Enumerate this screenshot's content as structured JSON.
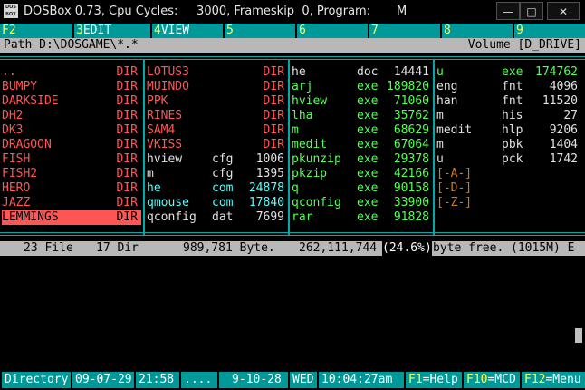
{
  "titlebar": {
    "icon_text": "DOS\nBOX",
    "title": "DOSBox 0.73, Cpu Cycles:     3000, Frameskip  0, Program:       M",
    "minimize_icon": "minimize-icon",
    "maximize_icon": "maximize-icon",
    "close_icon": "close-icon"
  },
  "fkeys": [
    {
      "key": "F2",
      "label": ""
    },
    {
      "key": "3",
      "label": "EDIT"
    },
    {
      "key": "4",
      "label": "VIEW"
    },
    {
      "key": "5",
      "label": ""
    },
    {
      "key": "6",
      "label": ""
    },
    {
      "key": "7",
      "label": ""
    },
    {
      "key": "8",
      "label": ""
    },
    {
      "key": "9",
      "label": ""
    }
  ],
  "pathbar": {
    "path": "Path D:\\DOSGAME\\*.*",
    "volume": "Volume [D_DRIVE]"
  },
  "panel": {
    "col1": [
      {
        "name": "..",
        "type": "DIR",
        "selected": false
      },
      {
        "name": "BUMPY",
        "type": "DIR",
        "selected": false
      },
      {
        "name": "DARKSIDE",
        "type": "DIR",
        "selected": false
      },
      {
        "name": "DH2",
        "type": "DIR",
        "selected": false
      },
      {
        "name": "DK3",
        "type": "DIR",
        "selected": false
      },
      {
        "name": "DRAGOON",
        "type": "DIR",
        "selected": false
      },
      {
        "name": "FISH",
        "type": "DIR",
        "selected": false
      },
      {
        "name": "FISH2",
        "type": "DIR",
        "selected": false
      },
      {
        "name": "HERO",
        "type": "DIR",
        "selected": false
      },
      {
        "name": "JAZZ",
        "type": "DIR",
        "selected": false
      },
      {
        "name": "LEMMINGS",
        "type": "DIR",
        "selected": true
      }
    ],
    "col2": [
      {
        "name": "LOTUS3",
        "ext": "",
        "size": "DIR",
        "color": "red"
      },
      {
        "name": "MUINDO",
        "ext": "",
        "size": "DIR",
        "color": "red"
      },
      {
        "name": "PPK",
        "ext": "",
        "size": "DIR",
        "color": "red"
      },
      {
        "name": "RINES",
        "ext": "",
        "size": "DIR",
        "color": "red"
      },
      {
        "name": "SAM4",
        "ext": "",
        "size": "DIR",
        "color": "red"
      },
      {
        "name": "VKISS",
        "ext": "",
        "size": "DIR",
        "color": "red"
      },
      {
        "name": "hview",
        "ext": "cfg",
        "size": "1006",
        "color": "white"
      },
      {
        "name": "m",
        "ext": "cfg",
        "size": "1395",
        "color": "white"
      },
      {
        "name": "he",
        "ext": "com",
        "size": "24878",
        "color": "cyan"
      },
      {
        "name": "qmouse",
        "ext": "com",
        "size": "17840",
        "color": "cyan"
      },
      {
        "name": "qconfig",
        "ext": "dat",
        "size": "7699",
        "color": "white"
      }
    ],
    "col3": [
      {
        "name": "he",
        "ext": "doc",
        "size": "14441",
        "color": "white"
      },
      {
        "name": "arj",
        "ext": "exe",
        "size": "189820",
        "color": "green"
      },
      {
        "name": "hview",
        "ext": "exe",
        "size": "71060",
        "color": "green"
      },
      {
        "name": "lha",
        "ext": "exe",
        "size": "35762",
        "color": "green"
      },
      {
        "name": "m",
        "ext": "exe",
        "size": "68629",
        "color": "green"
      },
      {
        "name": "medit",
        "ext": "exe",
        "size": "67064",
        "color": "green"
      },
      {
        "name": "pkunzip",
        "ext": "exe",
        "size": "29378",
        "color": "green"
      },
      {
        "name": "pkzip",
        "ext": "exe",
        "size": "42166",
        "color": "green"
      },
      {
        "name": "q",
        "ext": "exe",
        "size": "90158",
        "color": "green"
      },
      {
        "name": "qconfig",
        "ext": "exe",
        "size": "33900",
        "color": "green"
      },
      {
        "name": "rar",
        "ext": "exe",
        "size": "91828",
        "color": "green"
      }
    ],
    "col4": [
      {
        "name": "u",
        "ext": "exe",
        "size": "174762",
        "color": "green"
      },
      {
        "name": "eng",
        "ext": "fnt",
        "size": "4096",
        "color": "white"
      },
      {
        "name": "han",
        "ext": "fnt",
        "size": "11520",
        "color": "white"
      },
      {
        "name": "m",
        "ext": "his",
        "size": "27",
        "color": "white"
      },
      {
        "name": "medit",
        "ext": "hlp",
        "size": "9206",
        "color": "white"
      },
      {
        "name": "m",
        "ext": "pbk",
        "size": "1404",
        "color": "white"
      },
      {
        "name": "u",
        "ext": "pck",
        "size": "1742",
        "color": "white"
      },
      {
        "name": "[-A-]",
        "ext": "",
        "size": "",
        "color": "orange"
      },
      {
        "name": "[-D-]",
        "ext": "",
        "size": "",
        "color": "orange"
      },
      {
        "name": "[-Z-]",
        "ext": "",
        "size": "",
        "color": "orange"
      }
    ]
  },
  "status": {
    "files": "23 File",
    "dirs": "17 Dir",
    "bytes": "989,781 Byte.",
    "free": "262,111,744",
    "free_pct": "(24.6%)",
    "free_label": "byte free.",
    "free_mb": "(1015M) E"
  },
  "bottombar": {
    "directory": "Directory",
    "date": "09-07-29",
    "time": "21:58",
    "dots": "....",
    "sysdate": "9-10-28",
    "weekday": "WED",
    "clock": "10:04:27am",
    "f1_key": "F1",
    "f1_label": "=Help",
    "f10_key": "F10",
    "f10_label": "=MCD",
    "f12_key": "F12",
    "f12_label": "=Menu"
  },
  "colors": {
    "accent": "#009999",
    "dir": "#ff5555",
    "exe": "#55ff55",
    "com": "#55ffff",
    "bar": "#b8b8b8"
  }
}
